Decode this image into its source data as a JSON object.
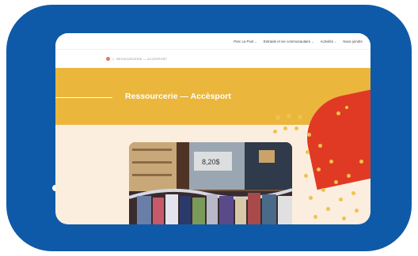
{
  "nav": {
    "items": [
      {
        "label": "Parc La Pool"
      },
      {
        "label": "Entraide et vie communautaire"
      },
      {
        "label": "Activités"
      },
      {
        "label": "Nous joindre"
      }
    ]
  },
  "breadcrumb": {
    "separator": ">",
    "items": [
      "RESSOURCERIE — ACCÈSPORT"
    ]
  },
  "hero": {
    "title": "Ressourcerie — Accèsport"
  },
  "colors": {
    "frame": "#0f5aa8",
    "banner": "#eab63c",
    "accent_red": "#e03a24",
    "dots": "#f0c24e",
    "page_bg": "#fbeede"
  },
  "photo": {
    "subject": "clothing rack in thrift store"
  }
}
